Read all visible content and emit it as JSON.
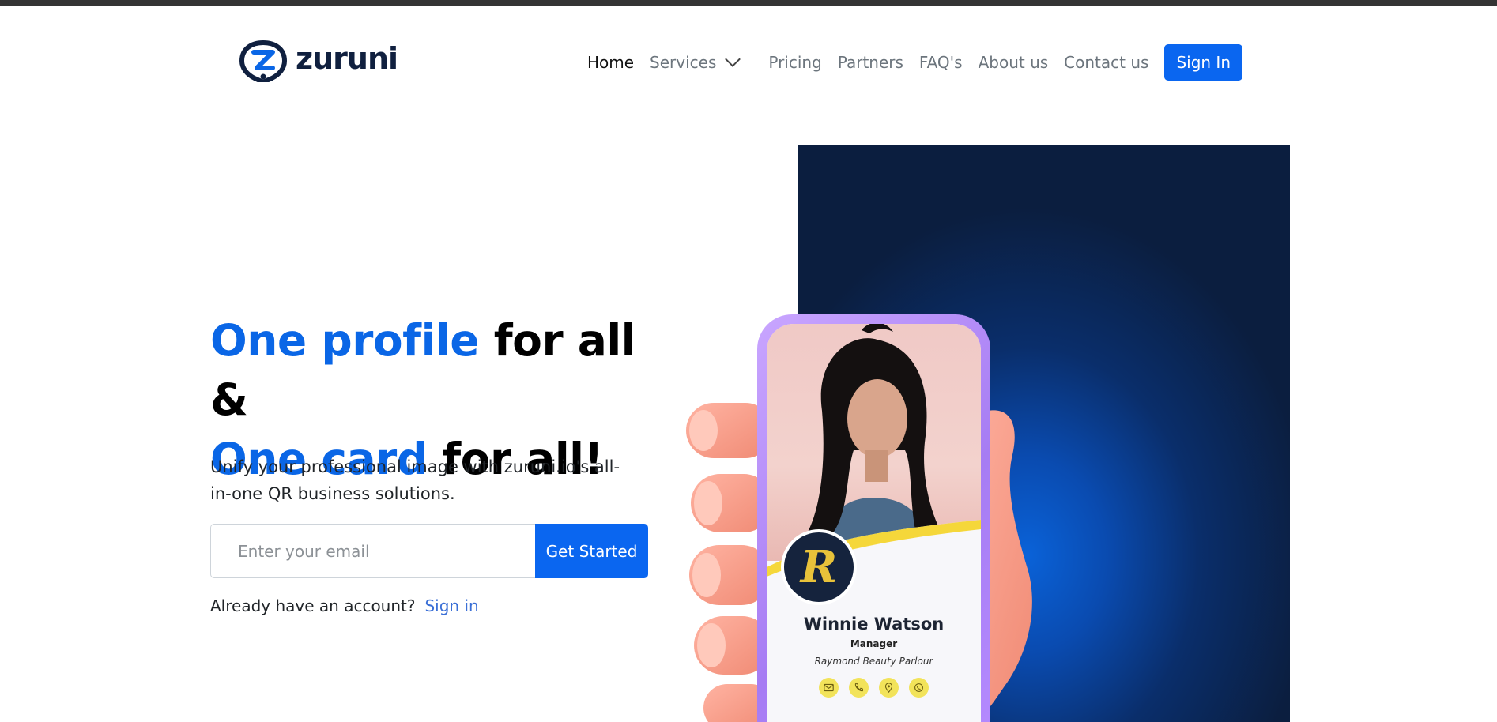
{
  "brand": {
    "name": "zuruni"
  },
  "nav": {
    "items": [
      {
        "label": "Home",
        "active": true
      },
      {
        "label": "Services",
        "dropdown": true
      },
      {
        "label": "Pricing"
      },
      {
        "label": "Partners"
      },
      {
        "label": "FAQ's"
      },
      {
        "label": "About us"
      },
      {
        "label": "Contact us"
      }
    ],
    "signin_label": "Sign In"
  },
  "hero": {
    "title_line1_highlight": "One profile",
    "title_line1_rest": " for all &",
    "title_line2_highlight": "One card",
    "title_line2_rest": " for all!",
    "subtitle": "Unify your professional image with zuruni.io's all-in-one QR business solutions.",
    "email_placeholder": "Enter your email",
    "cta_label": "Get Started",
    "already_text": "Already have an account?",
    "signin_link": "Sign in"
  },
  "card": {
    "logo_letter": "R",
    "name": "Winnie Watson",
    "role": "Manager",
    "company": "Raymond Beauty Parlour",
    "icons": [
      "mail-icon",
      "phone-icon",
      "location-icon",
      "whatsapp-icon"
    ]
  },
  "colors": {
    "accent": "#0a66f0",
    "highlight_text": "#0a66e6",
    "panel_dark": "#0b1e3f",
    "phone_frame": "#a67cf3",
    "card_icon_bg": "#f2e35a"
  }
}
